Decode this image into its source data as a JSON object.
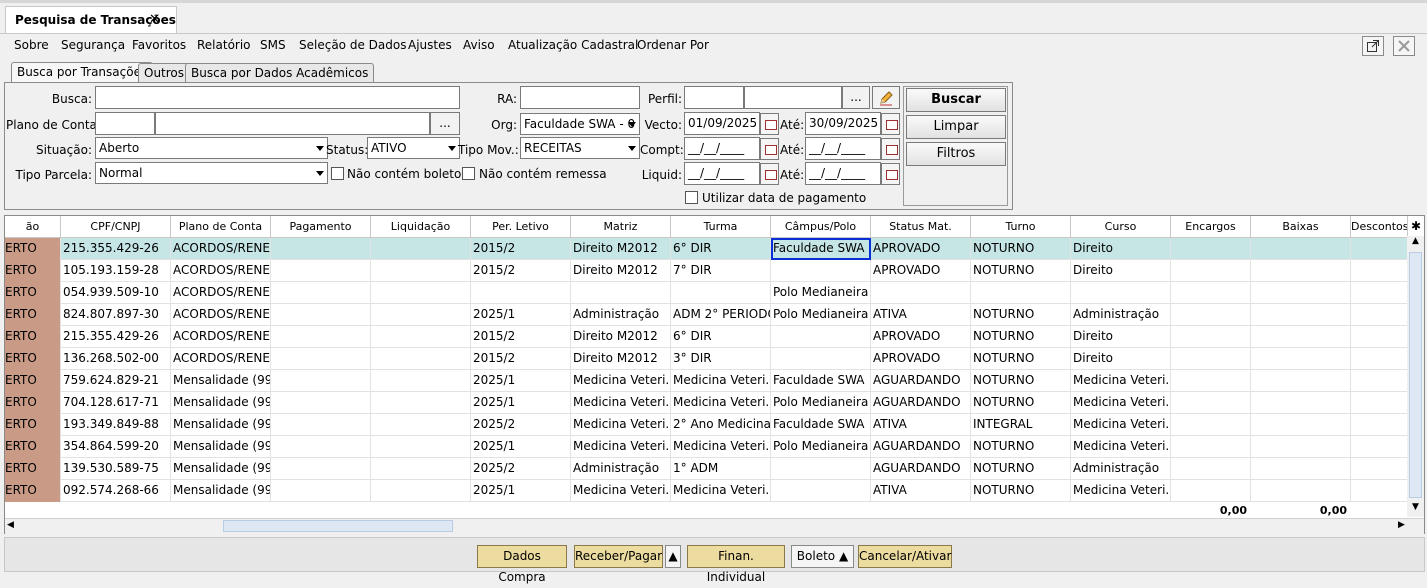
{
  "doc_tab": {
    "title": "Pesquisa de Transações",
    "close": "✕"
  },
  "menu": [
    "Sobre",
    "Segurança",
    "Favoritos",
    "Relatório",
    "SMS",
    "Seleção de Dados",
    "Ajustes",
    "Aviso",
    "Atualização Cadastral",
    "Ordenar Por"
  ],
  "tabs": [
    "Busca por Transações",
    "Outros",
    "Busca por Dados Acadêmicos"
  ],
  "form": {
    "busca_label": "Busca:",
    "busca_value": "",
    "ra_label": "RA:",
    "ra_value": "",
    "perfil_label": "Perfil:",
    "ellipsis": "...",
    "plano_label": "Plano de Conta:",
    "org_label": "Org:",
    "org_value": "Faculdade SWA - 0",
    "vecto_label": "Vecto:",
    "vecto_from": "01/09/2025",
    "ate_label": "Até:",
    "vecto_to": "30/09/2025",
    "situacao_label": "Situação:",
    "situacao_value": "Aberto",
    "status_label": "Status:",
    "status_value": "ATIVO",
    "tipo_mov_label": "Tipo Mov.:",
    "tipo_mov_value": "RECEITAS",
    "compt_label": "Compt:",
    "compt_from": "__/__/____",
    "compt_to": "__/__/____",
    "tipo_parcela_label": "Tipo Parcela:",
    "tipo_parcela_value": "Normal",
    "nao_boleto": "Não contém boleto",
    "nao_remessa": "Não contém remessa",
    "liquid_label": "Liquid:",
    "liquid_from": "__/__/____",
    "liquid_to": "__/__/____",
    "utilizar_data": "Utilizar data de pagamento"
  },
  "buttons": {
    "buscar": "Buscar",
    "limpar": "Limpar",
    "filtros": "Filtros"
  },
  "grid": {
    "headers": [
      "ão",
      "CPF/CNPJ",
      "Plano de Conta",
      "Pagamento",
      "Liquidação",
      "Per. Letivo",
      "Matriz",
      "Turma",
      "Câmpus/Polo",
      "Status Mat.",
      "Turno",
      "Curso",
      "Encargos",
      "Baixas",
      "Descontos"
    ],
    "rows": [
      [
        "ERTO",
        "215.355.429-26",
        "ACORDOS/RENE...",
        "",
        "",
        "2015/2",
        "Direito M2012",
        "6° DIR",
        "Faculdade SWA",
        "APROVADO",
        "NOTURNO",
        "Direito"
      ],
      [
        "ERTO",
        "105.193.159-28",
        "ACORDOS/RENE...",
        "",
        "",
        "2015/2",
        "Direito M2012",
        "7° DIR",
        "",
        "APROVADO",
        "NOTURNO",
        "Direito"
      ],
      [
        "ERTO",
        "054.939.509-10",
        "ACORDOS/RENE...",
        "",
        "",
        "",
        "",
        "",
        "Polo Medianeira",
        "",
        "",
        ""
      ],
      [
        "ERTO",
        "824.807.897-30",
        "ACORDOS/RENE...",
        "",
        "",
        "2025/1",
        "Administração",
        "ADM 2° PERIODO",
        "Polo Medianeira",
        "ATIVA",
        "NOTURNO",
        "Administração"
      ],
      [
        "ERTO",
        "215.355.429-26",
        "ACORDOS/RENE...",
        "",
        "",
        "2015/2",
        "Direito M2012",
        "6° DIR",
        "",
        "APROVADO",
        "NOTURNO",
        "Direito"
      ],
      [
        "ERTO",
        "136.268.502-00",
        "ACORDOS/RENE...",
        "",
        "",
        "2015/2",
        "Direito M2012",
        "3° DIR",
        "",
        "APROVADO",
        "NOTURNO",
        "Direito"
      ],
      [
        "ERTO",
        "759.624.829-21",
        "Mensalidade (99...",
        "",
        "",
        "2025/1",
        "Medicina Veteri...",
        "Medicina Veteri...",
        "Faculdade SWA",
        "AGUARDANDO",
        "NOTURNO",
        "Medicina Veteri..."
      ],
      [
        "ERTO",
        "704.128.617-71",
        "Mensalidade (99...",
        "",
        "",
        "2025/1",
        "Medicina Veteri...",
        "Medicina Veteri...",
        "Polo Medianeira",
        "AGUARDANDO",
        "NOTURNO",
        "Medicina Veteri..."
      ],
      [
        "ERTO",
        "193.349.849-88",
        "Mensalidade (99...",
        "",
        "",
        "2025/2",
        "Medicina Veteri...",
        "2° Ano Medicina...",
        "Faculdade SWA",
        "ATIVA",
        "INTEGRAL",
        "Medicina Veteri..."
      ],
      [
        "ERTO",
        "354.864.599-20",
        "Mensalidade (99...",
        "",
        "",
        "2025/1",
        "Medicina Veteri...",
        "Medicina Veteri...",
        "Polo Medianeira",
        "AGUARDANDO",
        "NOTURNO",
        "Medicina Veteri..."
      ],
      [
        "ERTO",
        "139.530.589-75",
        "Mensalidade (99...",
        "",
        "",
        "2025/2",
        "Administração",
        "1° ADM",
        "",
        "AGUARDANDO",
        "NOTURNO",
        "Administração"
      ],
      [
        "ERTO",
        "092.574.268-66",
        "Mensalidade (99...",
        "",
        "",
        "2025/1",
        "Medicina Veteri...",
        "Medicina Veteri...",
        "",
        "ATIVA",
        "NOTURNO",
        "Medicina Veteri..."
      ]
    ],
    "totals": {
      "encargos": "0,00",
      "baixas": "0,00"
    }
  },
  "actions": [
    "Dados Compra",
    "Receber/Pagar",
    "Finan. Individual",
    "Boleto",
    "Cancelar/Ativar"
  ]
}
